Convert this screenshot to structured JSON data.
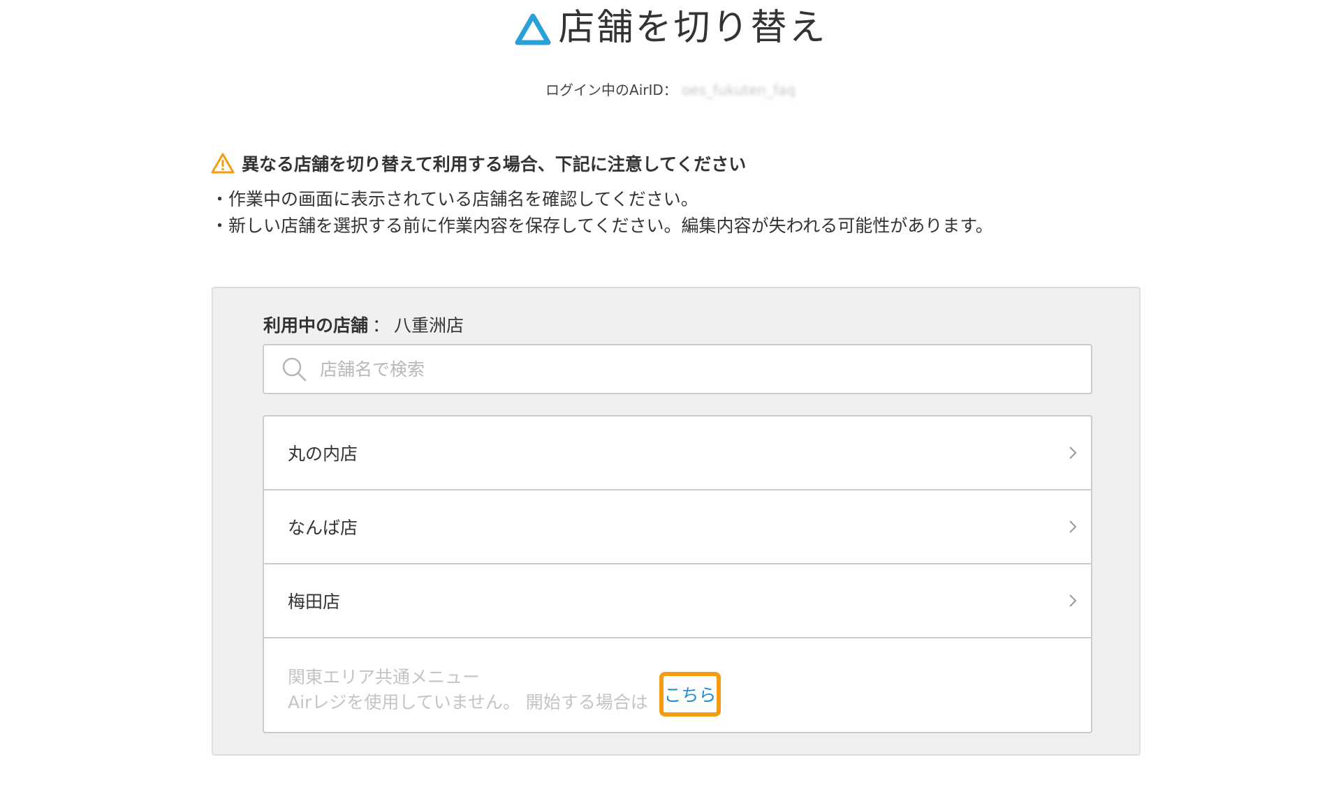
{
  "header": {
    "title": "店舗を切り替え",
    "brand_color": "#2aa0d9"
  },
  "login": {
    "label": "ログイン中のAirID：",
    "airid": "oes_fukuten_faq"
  },
  "notice": {
    "heading": "異なる店舗を切り替えて利用する場合、下記に注意してください",
    "lines": [
      "・作業中の画面に表示されている店舗名を確認してください。",
      "・新しい店舗を選択する前に作業内容を保存してください。編集内容が失われる可能性があります。"
    ],
    "icon": "warning-icon",
    "icon_color": "#f39c12"
  },
  "current_store": {
    "label": "利用中の店舗",
    "separator": "：",
    "name": "八重洲店"
  },
  "search": {
    "placeholder": "店舗名で検索",
    "value": ""
  },
  "stores": [
    {
      "name": "丸の内店"
    },
    {
      "name": "なんば店"
    },
    {
      "name": "梅田店"
    }
  ],
  "inactive_store": {
    "name": "関東エリア共通メニュー",
    "message": "Airレジを使用していません。 開始する場合は",
    "link_label": "こちら",
    "link_color": "#1a8fd6",
    "highlight_color": "#f39c12"
  }
}
